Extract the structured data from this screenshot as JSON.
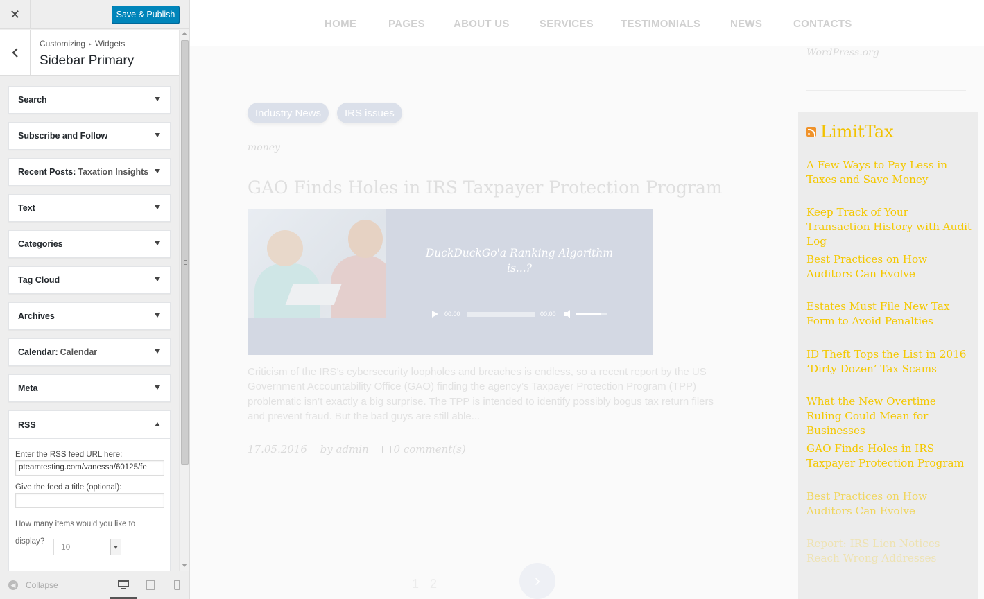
{
  "customizer": {
    "close_icon": "close-icon",
    "publish_label": "Save & Publish",
    "breadcrumb": {
      "root": "Customizing",
      "current": "Widgets"
    },
    "section_title": "Sidebar Primary",
    "widgets": [
      {
        "title": "Search",
        "instance_title": ""
      },
      {
        "title": "Subscribe and Follow",
        "instance_title": ""
      },
      {
        "title": "Recent Posts:",
        "instance_title": "Taxation Insights"
      },
      {
        "title": "Text",
        "instance_title": ""
      },
      {
        "title": "Categories",
        "instance_title": ""
      },
      {
        "title": "Tag Cloud",
        "instance_title": ""
      },
      {
        "title": "Archives",
        "instance_title": ""
      },
      {
        "title": "Calendar:",
        "instance_title": "Calendar"
      },
      {
        "title": "Meta",
        "instance_title": ""
      }
    ],
    "rss_widget": {
      "title": "RSS",
      "url_label": "Enter the RSS feed URL here:",
      "url_value": "pteamtesting.com/vanessa/60125/fe",
      "title_label": "Give the feed a title (optional):",
      "title_value": "",
      "count_label": "How many items would you like to display?",
      "count_value": "10"
    },
    "footer": {
      "collapse_label": "Collapse"
    }
  },
  "preview": {
    "nav": [
      "HOME",
      "PAGES",
      "ABOUT US",
      "SERVICES",
      "TESTIMONIALS",
      "NEWS",
      "CONTACTS"
    ],
    "wp_link": "WordPress.org",
    "post": {
      "tags": [
        "Industry News",
        "IRS issues"
      ],
      "category": "money",
      "title": "GAO Finds Holes in IRS Taxpayer Protection Program",
      "audio_title": "DuckDuckGo'a Ranking Algorithm is...?",
      "time_current": "00:00",
      "time_duration": "00:00",
      "excerpt": "Criticism of the IRS’s cybersecurity loopholes and breaches is endless, so a recent report by the US Government Accountability Office (GAO) finding the agency’s Taxpayer Protection Program (TPP) problematic isn’t exactly a big surprise. The TPP is intended to identify possibly bogus tax return filers and prevent fraud. But the bad guys are still able...",
      "date": "17.05.2016",
      "author": "by admin",
      "comments": "0 comment(s)"
    },
    "pagination": {
      "pages": [
        "1",
        "2"
      ]
    },
    "rss_panel": {
      "title": "LimitTax",
      "items": [
        "A Few Ways to Pay Less in Taxes and Save Money",
        "Keep Track of Your Transaction History with Audit Log",
        "Best Practices on How Auditors Can Evolve",
        "Estates Must File New Tax Form to Avoid Penalties",
        "ID Theft Tops the List in 2016 ‘Dirty Dozen’ Tax Scams",
        "What the New Overtime Ruling Could Mean for Businesses",
        "GAO Finds Holes in IRS Taxpayer Protection Program",
        "Best Practices on How Auditors Can Evolve",
        "Report: IRS Lien Notices Reach Wrong Addresses"
      ]
    }
  },
  "colors": {
    "accent": "#0085ba",
    "rss_link": "#f4c800"
  }
}
